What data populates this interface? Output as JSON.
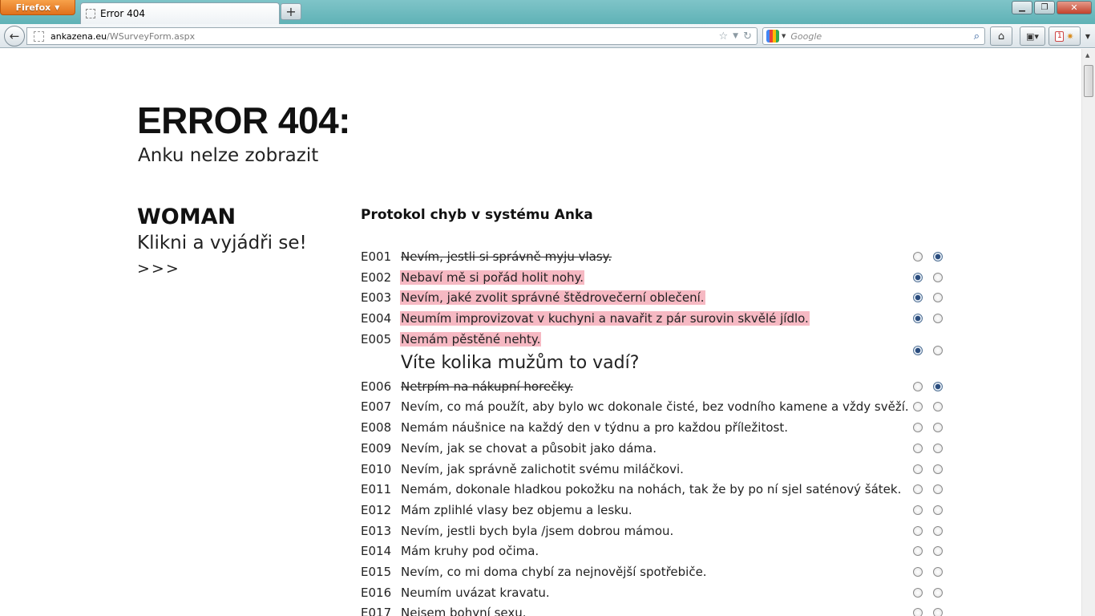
{
  "browser": {
    "menu_button": "Firefox",
    "tab_title": "Error 404",
    "new_tab": "+",
    "url_domain": "ankazena.eu",
    "url_path": "/WSurveyForm.aspx",
    "search_placeholder": "Google",
    "badge_count": "1"
  },
  "page": {
    "title": "ERROR 404:",
    "subtitle": "Anku nelze zobrazit",
    "sidebar": {
      "title": "WOMAN",
      "subtitle": "Klikni a vyjádři se!",
      "arrows": ">>>"
    },
    "protocol_title": "Protokol chyb v systému Anka",
    "items": [
      {
        "code": "E001",
        "text": "Nevím, jestli si správně myju vlasy.",
        "style": "strike",
        "selected": 2
      },
      {
        "code": "E002",
        "text": "Nebaví mě si pořád holit nohy.",
        "style": "highlight",
        "selected": 1
      },
      {
        "code": "E003",
        "text": "Nevím, jaké zvolit správné štědrovečerní oblečení.",
        "style": "highlight",
        "selected": 1
      },
      {
        "code": "E004",
        "text": "Neumím improvizovat v kuchyni a navařit z pár surovin skvělé jídlo.",
        "style": "highlight",
        "selected": 1
      },
      {
        "code": "E005",
        "text": "Nemám pěstěné nehty.",
        "style": "highlight",
        "extra": "Víte kolika mužům to vadí?",
        "selected": 1
      },
      {
        "code": "E006",
        "text": "Netrpím na nákupní horečky.",
        "style": "strike",
        "selected": 2
      },
      {
        "code": "E007",
        "text": "Nevím, co má použít, aby bylo wc dokonale čisté, bez vodního kamene a vždy svěží.",
        "style": "normal",
        "selected": 0
      },
      {
        "code": "E008",
        "text": "Nemám náušnice na každý den v týdnu a pro každou příležitost.",
        "style": "normal",
        "selected": 0
      },
      {
        "code": "E009",
        "text": "Nevím, jak se chovat a působit jako dáma.",
        "style": "normal",
        "selected": 0
      },
      {
        "code": "E010",
        "text": "Nevím, jak správně zalichotit svému miláčkovi.",
        "style": "normal",
        "selected": 0
      },
      {
        "code": "E011",
        "text": "Nemám, dokonale hladkou pokožku na nohách, tak že by po ní sjel saténový šátek.",
        "style": "normal",
        "selected": 0
      },
      {
        "code": "E012",
        "text": "Mám zplihlé vlasy bez objemu a lesku.",
        "style": "normal",
        "selected": 0
      },
      {
        "code": "E013",
        "text": "Nevím, jestli bych byla /jsem dobrou mámou.",
        "style": "normal",
        "selected": 0
      },
      {
        "code": "E014",
        "text": "Mám kruhy pod očima.",
        "style": "normal",
        "selected": 0
      },
      {
        "code": "E015",
        "text": "Nevím, co mi doma chybí za nejnovější spotřebiče.",
        "style": "normal",
        "selected": 0
      },
      {
        "code": "E016",
        "text": "Neumím uvázat kravatu.",
        "style": "normal",
        "selected": 0
      },
      {
        "code": "E017",
        "text": "Nejsem bohyní sexu.",
        "style": "normal",
        "selected": 0
      }
    ]
  },
  "colors": {
    "highlight": "#f6b9c3",
    "titlebar": "#6fbcc0",
    "firefox_button": "#e8842e"
  }
}
